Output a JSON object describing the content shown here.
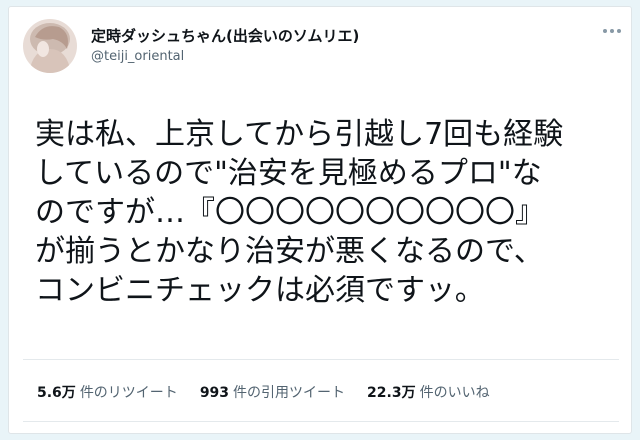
{
  "tweet": {
    "author": {
      "display_name": "定時ダッシュちゃん(出会いのソムリエ)",
      "handle": "@teiji_oriental"
    },
    "more_icon": "more-horizontal-icon",
    "text_lines": [
      "実は私、上京してから引越し7回も経験",
      "しているので\"治安を見極めるプロ\"な",
      "のですが…『〇〇〇〇〇〇〇〇〇〇』",
      "が揃うとかなり治安が悪くなるので、",
      "コンビニチェックは必須ですッ。"
    ],
    "stats": [
      {
        "value": "5.6万",
        "label": "件のリツイート"
      },
      {
        "value": "993",
        "label": "件の引用ツイート"
      },
      {
        "value": "22.3万",
        "label": "件のいいね"
      }
    ]
  },
  "colors": {
    "page_background": "#e9f4f8",
    "text_primary": "#0f1419",
    "text_secondary": "#536471"
  }
}
